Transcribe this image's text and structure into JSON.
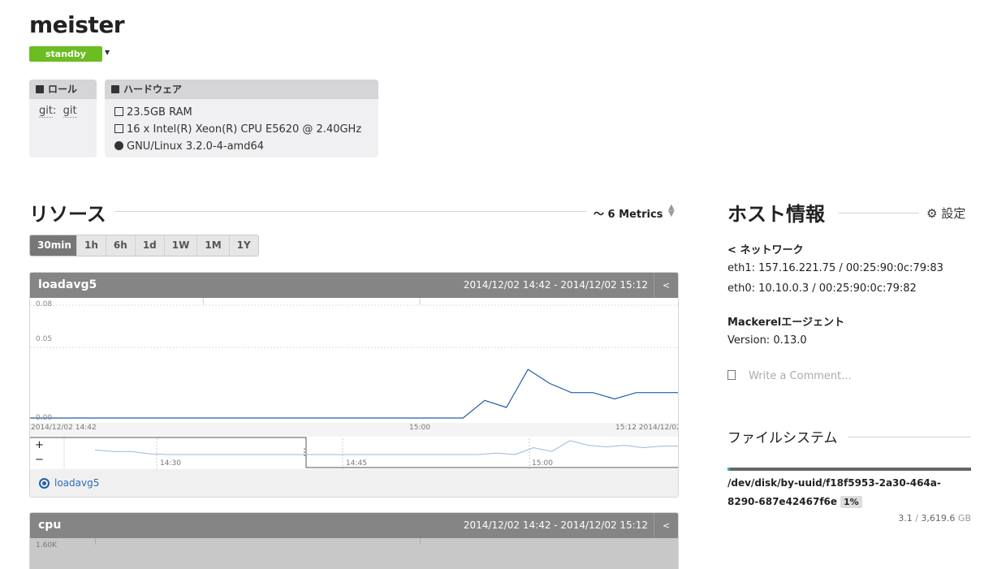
{
  "host": {
    "name": "meister",
    "status": "standby"
  },
  "role_box": {
    "title": "ロール",
    "service": "git",
    "role": "git"
  },
  "hardware_box": {
    "title": "ハードウェア",
    "memory": "23.5GB RAM",
    "cpu": "16 x Intel(R) Xeon(R) CPU E5620 @ 2.40GHz",
    "os": "GNU/Linux 3.2.0-4-amd64"
  },
  "resources": {
    "title": "リソース",
    "metrics_label": "6 Metrics",
    "ranges": [
      "30min",
      "1h",
      "6h",
      "1d",
      "1W",
      "1M",
      "1Y"
    ],
    "active_range": "30min"
  },
  "graphs": [
    {
      "name": "loadavg5",
      "range": "2014/12/02 14:42 - 2014/12/02 15:12",
      "legend": "loadavg5"
    },
    {
      "name": "cpu",
      "range": "2014/12/02 14:42 - 2014/12/02 15:12",
      "y_top_tick": "1.60K"
    }
  ],
  "chart_data": {
    "type": "line",
    "series": [
      {
        "name": "loadavg5",
        "x": [
          "14:42",
          "14:44",
          "14:46",
          "14:48",
          "14:50",
          "14:52",
          "14:54",
          "14:56",
          "14:58",
          "15:00",
          "15:02",
          "15:03",
          "15:04",
          "15:05",
          "15:06",
          "15:07",
          "15:08",
          "15:09",
          "15:10",
          "15:11",
          "15:12"
        ],
        "values": [
          0.0,
          0.0,
          0.0,
          0.0,
          0.0,
          0.0,
          0.0,
          0.0,
          0.0,
          0.0,
          0.0,
          0.0125,
          0.0075,
          0.0345,
          0.0245,
          0.018,
          0.018,
          0.0135,
          0.018,
          0.018,
          0.018
        ]
      }
    ],
    "ylim": [
      0,
      0.08
    ],
    "y_ticks": [
      "0.00",
      "0.05",
      "0.08"
    ],
    "x_ticks": [
      "2014/12/02 14:42",
      "15:00",
      "15:12 2014/12/02"
    ],
    "navigator_ticks": [
      "14:30",
      "14:45",
      "15:00"
    ],
    "navigator_buttons": [
      "+",
      "−"
    ],
    "color": "#1f5fa8"
  },
  "host_info": {
    "title": "ホスト情報",
    "settings_label": "設定",
    "network_title": "ネットワーク",
    "interfaces": [
      "eth1: 157.16.221.75 / 00:25:90:0c:79:83",
      "eth0: 10.10.0.3 / 00:25:90:0c:79:82"
    ],
    "agent_title": "Mackerelエージェント",
    "agent_version": "Version: 0.13.0",
    "comment_placeholder": "Write a Comment..."
  },
  "filesystem": {
    "title": "ファイルシステム",
    "device": "/dev/disk/by-uuid/f18f5953-2a30-464a-8290-687e42467f6e",
    "percent": "1%",
    "used": "3.1",
    "separator": "/",
    "total": "3,619.6",
    "unit": "GB",
    "usage_fraction": 0.01
  },
  "colors": {
    "status": "#6bbd22",
    "line": "#1f5fa8",
    "header": "#858585"
  }
}
